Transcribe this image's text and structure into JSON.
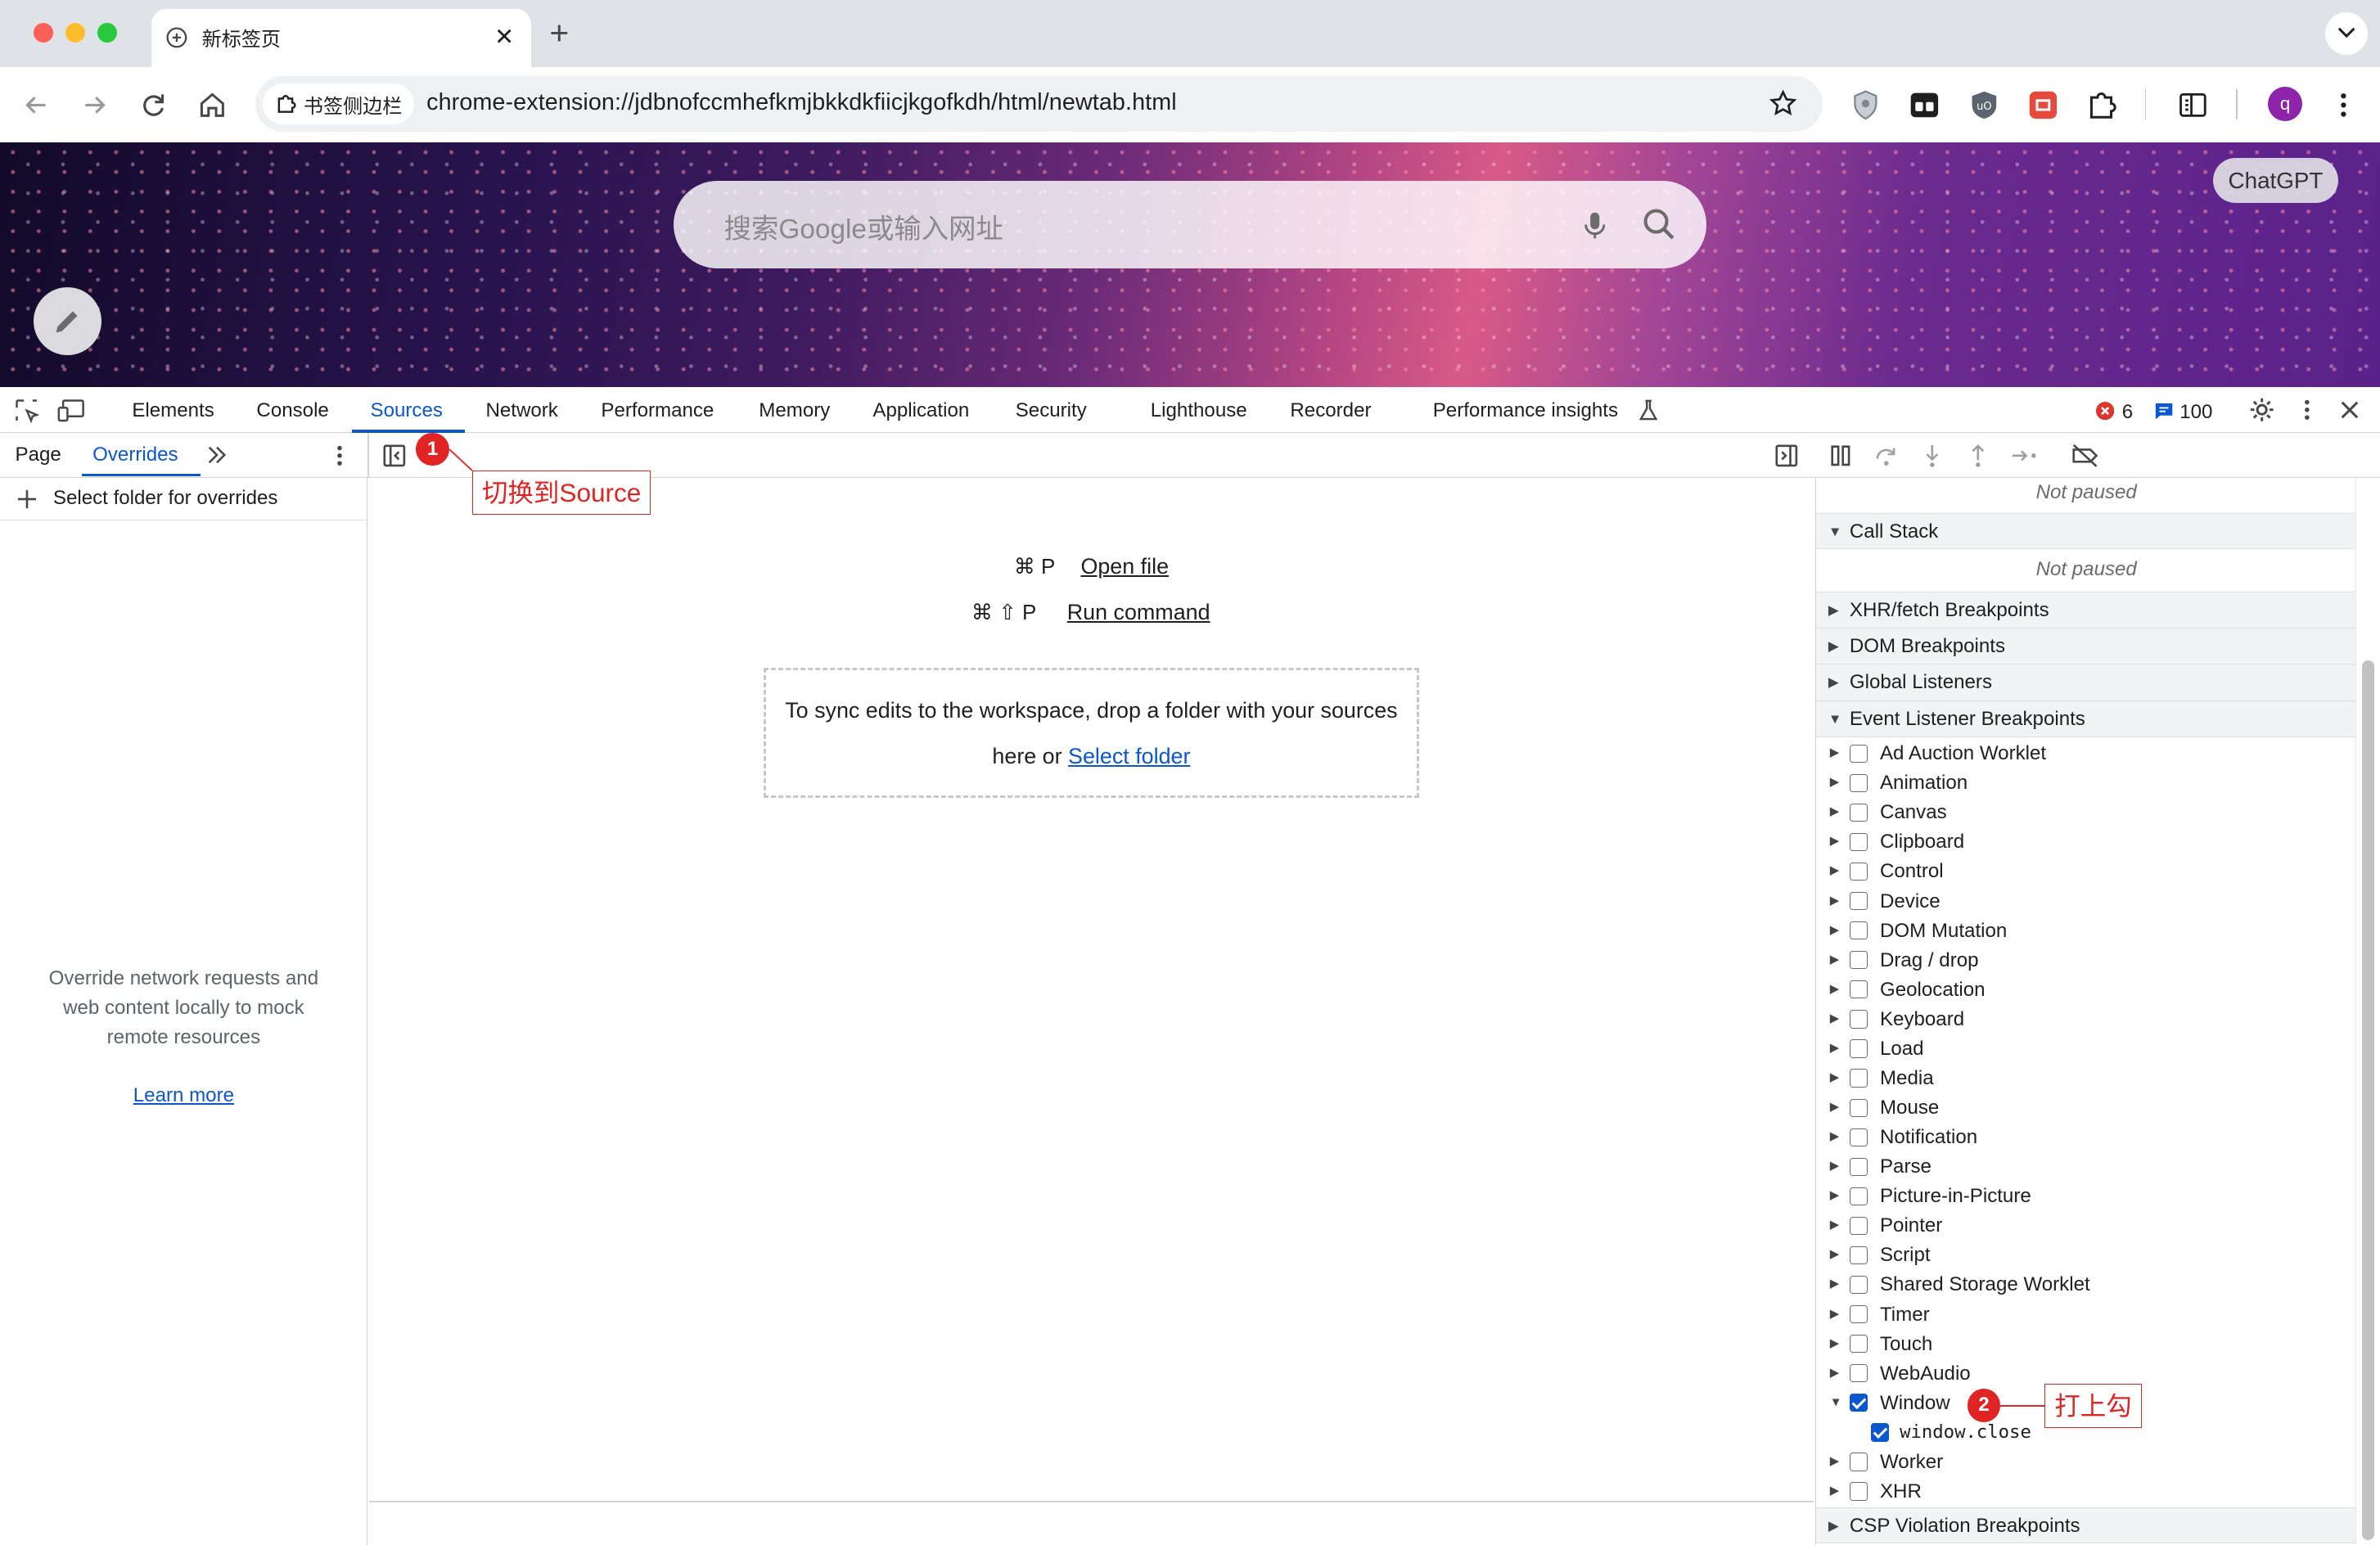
{
  "browser": {
    "tab_title": "新标签页",
    "new_tab_label": "+",
    "site_chip": "书签侧边栏",
    "url": "chrome-extension://jdbnofccmhefkmjbkkdkfiicjkgofkdh/html/newtab.html",
    "profile_initial": "q"
  },
  "newtab": {
    "search_placeholder": "搜索Google或输入网址",
    "chatgpt_button": "ChatGPT"
  },
  "devtools": {
    "tabs": [
      "Elements",
      "Console",
      "Sources",
      "Network",
      "Performance",
      "Memory",
      "Application",
      "Security",
      "Lighthouse",
      "Recorder",
      "Performance insights"
    ],
    "active_tab": "Sources",
    "error_count": "6",
    "message_count": "100",
    "left_tabs": [
      "Page",
      "Overrides"
    ],
    "active_left_tab": "Overrides",
    "select_folder_label": "Select folder for overrides",
    "overrides_empty_text": "Override network requests and web content locally to mock remote resources",
    "learn_more": "Learn more",
    "open_file_shortcut": "⌘ P",
    "open_file_label": "Open file",
    "run_command_shortcut": "⌘ ⇧ P",
    "run_command_label": "Run command",
    "drop_text": "To sync edits to the workspace, drop a folder with your sources here or",
    "select_folder_link": "Select folder",
    "not_paused_1": "Not paused",
    "call_stack": "Call Stack",
    "not_paused_2": "Not paused",
    "sections": [
      "XHR/fetch Breakpoints",
      "DOM Breakpoints",
      "Global Listeners",
      "Event Listener Breakpoints"
    ],
    "event_listeners": [
      {
        "label": "Ad Auction Worklet",
        "checked": false
      },
      {
        "label": "Animation",
        "checked": false
      },
      {
        "label": "Canvas",
        "checked": false
      },
      {
        "label": "Clipboard",
        "checked": false
      },
      {
        "label": "Control",
        "checked": false
      },
      {
        "label": "Device",
        "checked": false
      },
      {
        "label": "DOM Mutation",
        "checked": false
      },
      {
        "label": "Drag / drop",
        "checked": false
      },
      {
        "label": "Geolocation",
        "checked": false
      },
      {
        "label": "Keyboard",
        "checked": false
      },
      {
        "label": "Load",
        "checked": false
      },
      {
        "label": "Media",
        "checked": false
      },
      {
        "label": "Mouse",
        "checked": false
      },
      {
        "label": "Notification",
        "checked": false
      },
      {
        "label": "Parse",
        "checked": false
      },
      {
        "label": "Picture-in-Picture",
        "checked": false
      },
      {
        "label": "Pointer",
        "checked": false
      },
      {
        "label": "Script",
        "checked": false
      },
      {
        "label": "Shared Storage Worklet",
        "checked": false
      },
      {
        "label": "Timer",
        "checked": false
      },
      {
        "label": "Touch",
        "checked": false
      },
      {
        "label": "WebAudio",
        "checked": false
      },
      {
        "label": "Window",
        "checked": true,
        "expanded": true
      },
      {
        "label": "window.close",
        "checked": true,
        "child": true
      },
      {
        "label": "Worker",
        "checked": false
      },
      {
        "label": "XHR",
        "checked": false
      }
    ],
    "csp_section": "CSP Violation Breakpoints"
  },
  "annotations": {
    "badge1": "1",
    "label1": "切换到Source",
    "badge2": "2",
    "label2": "打上勾"
  },
  "colors": {
    "accent": "#0b57d0",
    "annotation_red": "#e02424"
  }
}
